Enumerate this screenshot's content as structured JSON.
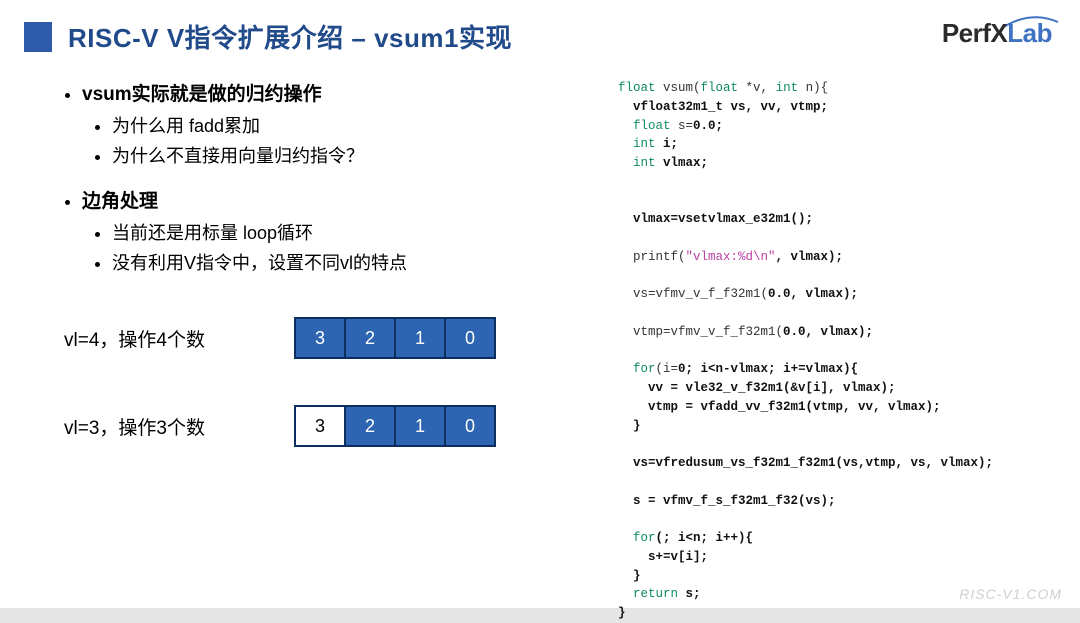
{
  "title": "RISC-V V指令扩展介绍 – vsum1实现",
  "logo": {
    "perf": "Perf",
    "lab": "Lab"
  },
  "bullets": {
    "b1": "vsum实际就是做的归约操作",
    "b1a": "为什么用 fadd累加",
    "b1b": "为什么不直接用向量归约指令？",
    "b2": "边角处理",
    "b2a": "当前还是用标量 loop循环",
    "b2b": "没有利用V指令中，设置不同vl的特点"
  },
  "vrows": {
    "r1label": "vl=4，操作4个数",
    "r1": [
      "3",
      "2",
      "1",
      "0"
    ],
    "r2label": "vl=3，操作3个数",
    "r2": [
      "3",
      "2",
      "1",
      "0"
    ]
  },
  "code": {
    "l1a": "float",
    "l1b": " vsum(",
    "l1c": "float",
    "l1d": " *v, ",
    "l1e": "int",
    "l1f": " n){",
    "l2a": "  vfloat32m1_t vs, vv, vtmp;",
    "l3a": "  ",
    "l3b": "float",
    "l3c": " s=",
    "l3d": "0.0;",
    "l4a": "  ",
    "l4b": "int",
    "l4c": " i;",
    "l5a": "  ",
    "l5b": "int",
    "l5c": " vlmax;",
    "l6": "",
    "l7": "  vlmax=vsetvlmax_e32m1();",
    "l8": "",
    "l9a": "  printf(",
    "l9b": "\"vlmax:%d\\n\"",
    "l9c": ", vlmax);",
    "l10": "",
    "l11a": "  vs=vfmv_v_f_f32m1(",
    "l11b": "0.0, vlmax);",
    "l12": "",
    "l13a": "  vtmp=vfmv_v_f_f32m1(",
    "l13b": "0.0, vlmax);",
    "l14": "",
    "l15a": "  ",
    "l15b": "for",
    "l15c": "(i=",
    "l15d": "0; i<n-vlmax; i+=vlmax){",
    "l16": "    vv = vle32_v_f32m1(&v[i], vlmax);",
    "l17": "    vtmp = vfadd_vv_f32m1(vtmp, vv, vlmax);",
    "l18": "  }",
    "l19": "",
    "l20": "  vs=vfredusum_vs_f32m1_f32m1(vs,vtmp, vs, vlmax);",
    "l21": "",
    "l22": "  s = vfmv_f_s_f32m1_f32(vs);",
    "l23": "",
    "l24a": "  ",
    "l24b": "for",
    "l24c": "(; i<n; i++){",
    "l25": "    s+=v[i];",
    "l26": "  }",
    "l27a": "  ",
    "l27b": "return",
    "l27c": " s;",
    "l28": "}"
  },
  "watermark": "RISC-V1.COM"
}
